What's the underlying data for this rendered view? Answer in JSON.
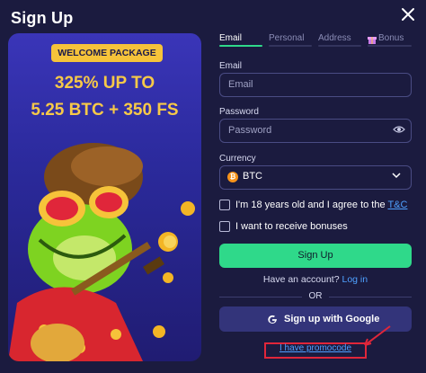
{
  "modal": {
    "title": "Sign Up"
  },
  "promo": {
    "badge": "WELCOME PACKAGE",
    "line1": "325% UP TO",
    "line2": "5.25 BTC + 350 FS"
  },
  "steps": [
    {
      "label": "Email",
      "active": true
    },
    {
      "label": "Personal",
      "active": false
    },
    {
      "label": "Address",
      "active": false
    },
    {
      "label": "Bonus",
      "active": false
    }
  ],
  "form": {
    "email_label": "Email",
    "email_placeholder": "Email",
    "password_label": "Password",
    "password_placeholder": "Password",
    "currency_label": "Currency",
    "currency_value": "BTC",
    "terms_text": "I'm 18 years old and I agree to the",
    "terms_link": "T&C",
    "bonuses_text": "I want to receive bonuses",
    "signup_label": "Sign Up",
    "have_account_text": "Have an account?",
    "login_link": "Log in",
    "or_text": "OR",
    "google_label": "Sign up with Google",
    "promocode_link": "I have promocode"
  },
  "colors": {
    "background": "#1b1b3f",
    "accent_green": "#2fd98a",
    "link_blue": "#4fa0ff",
    "promo_gold": "#f7c948",
    "highlight_red": "#e0263a"
  }
}
